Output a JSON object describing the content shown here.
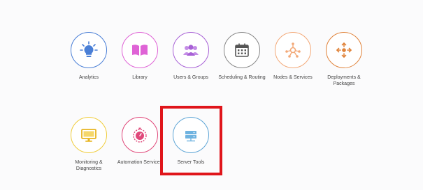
{
  "tiles": [
    {
      "label": "Analytics",
      "icon": "lightbulb-icon",
      "color": "#4a7fd6"
    },
    {
      "label": "Library",
      "icon": "book-icon",
      "color": "#df63d6"
    },
    {
      "label": "Users & Groups",
      "icon": "users-icon",
      "color": "#a861d6"
    },
    {
      "label": "Scheduling & Routing",
      "icon": "calendar-icon",
      "color": "#888888"
    },
    {
      "label": "Nodes & Services",
      "icon": "nodes-icon",
      "color": "#f3a978"
    },
    {
      "label": "Deployments & Packages",
      "icon": "move-arrows-icon",
      "color": "#e08239"
    },
    {
      "label": "Monitoring & Diagnostics",
      "icon": "monitor-icon",
      "color": "#f0cd3c"
    },
    {
      "label": "Automation Services",
      "icon": "stopwatch-icon",
      "color": "#e0487a"
    },
    {
      "label": "Server Tools",
      "icon": "server-icon",
      "color": "#5fa6d6"
    }
  ],
  "highlight": {
    "target": "Server Tools",
    "color": "#e0151b"
  }
}
